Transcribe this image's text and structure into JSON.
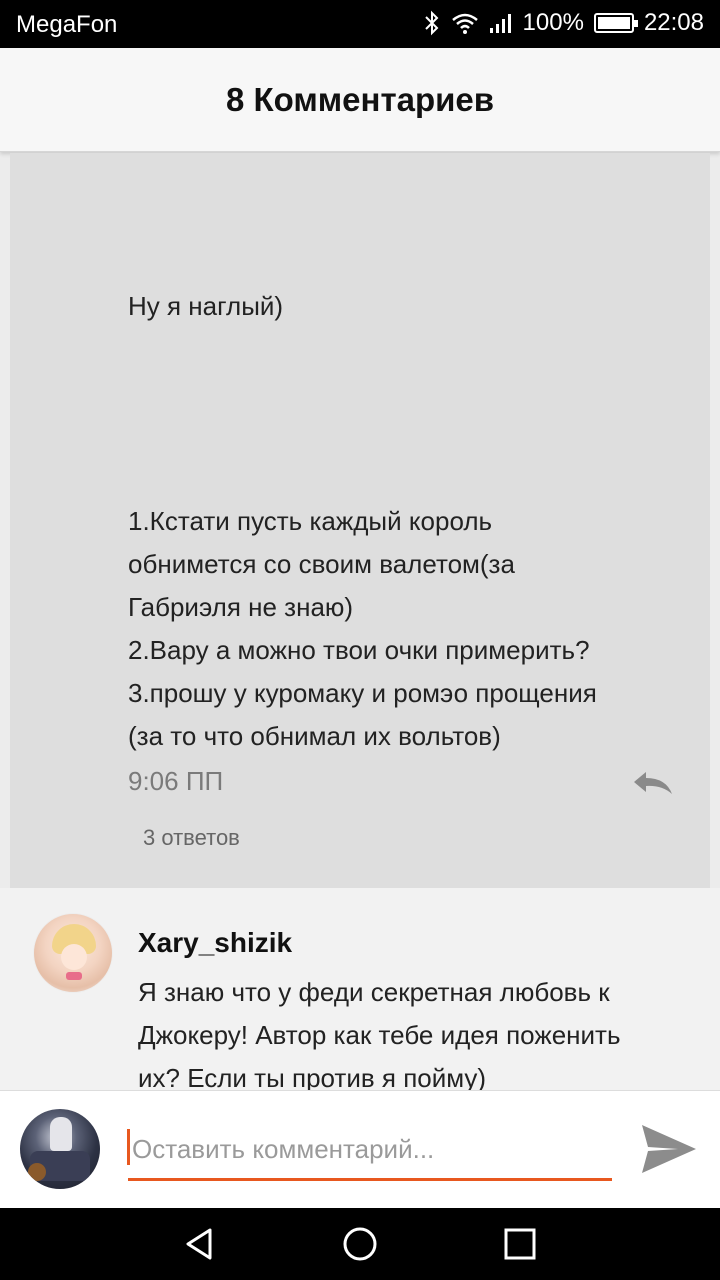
{
  "status_bar": {
    "carrier": "MegaFon",
    "battery": "100%",
    "time": "22:08",
    "icons": [
      "bluetooth-icon",
      "wifi-icon",
      "signal-icon",
      "battery-icon"
    ]
  },
  "header": {
    "title": "8 Комментариев"
  },
  "comments": [
    {
      "text_lines": [
        "Ну я наглый)",
        "1.Кстати пусть каждый король",
        "обнимется со своим валетом(за",
        "Габриэля не знаю)",
        "2.Вару а можно твои очки примерить?",
        "3.прошу у куромаку и ромэо прощения",
        "(за то что обнимал их вольтов)"
      ],
      "timestamp": "9:06 ПП",
      "replies": "3 ответов"
    },
    {
      "username": "Xary_shizik",
      "text_lines": [
        "Я знаю что у феди секретная любовь к",
        "Джокеру! Автор как тебе идея поженить",
        "их? Если ты против я пойму)"
      ]
    }
  ],
  "composer": {
    "placeholder": "Оставить комментарий..."
  },
  "colors": {
    "accent": "#e8581f",
    "highlight_bg": "#dedede"
  }
}
